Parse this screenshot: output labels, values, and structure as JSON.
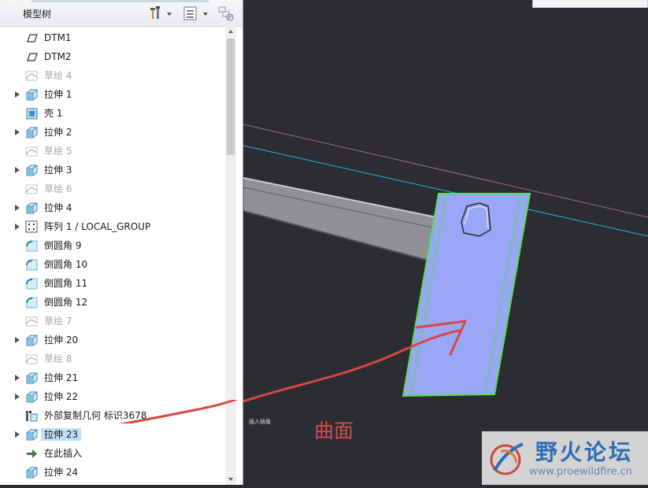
{
  "panel": {
    "title": "模型树",
    "tools_icon": "tools-icon",
    "settings_icon": "tree-settings-icon",
    "filter_icon": "tree-filter-icon"
  },
  "tree": [
    {
      "label": "DTM1",
      "icon": "datum-plane-icon",
      "expand": false,
      "dim": false,
      "selected": false
    },
    {
      "label": "DTM2",
      "icon": "datum-plane-icon",
      "expand": false,
      "dim": false,
      "selected": false
    },
    {
      "label": "草绘 4",
      "icon": "sketch-icon",
      "expand": false,
      "dim": true,
      "selected": false
    },
    {
      "label": "拉伸 1",
      "icon": "extrude-icon",
      "expand": true,
      "dim": false,
      "selected": false
    },
    {
      "label": "壳 1",
      "icon": "shell-icon",
      "expand": false,
      "dim": false,
      "selected": false
    },
    {
      "label": "拉伸 2",
      "icon": "extrude-icon",
      "expand": true,
      "dim": false,
      "selected": false
    },
    {
      "label": "草绘 5",
      "icon": "sketch-icon",
      "expand": false,
      "dim": true,
      "selected": false
    },
    {
      "label": "拉伸 3",
      "icon": "extrude-icon",
      "expand": true,
      "dim": false,
      "selected": false
    },
    {
      "label": "草绘 6",
      "icon": "sketch-icon",
      "expand": false,
      "dim": true,
      "selected": false
    },
    {
      "label": "拉伸 4",
      "icon": "extrude-icon",
      "expand": true,
      "dim": false,
      "selected": false
    },
    {
      "label": "阵列 1 / LOCAL_GROUP",
      "icon": "pattern-icon",
      "expand": true,
      "dim": false,
      "selected": false
    },
    {
      "label": "倒圆角 9",
      "icon": "round-icon",
      "expand": false,
      "dim": false,
      "selected": false
    },
    {
      "label": "倒圆角 10",
      "icon": "round-icon",
      "expand": false,
      "dim": false,
      "selected": false
    },
    {
      "label": "倒圆角 11",
      "icon": "round-icon",
      "expand": false,
      "dim": false,
      "selected": false
    },
    {
      "label": "倒圆角 12",
      "icon": "round-icon",
      "expand": false,
      "dim": false,
      "selected": false
    },
    {
      "label": "草绘 7",
      "icon": "sketch-icon",
      "expand": false,
      "dim": true,
      "selected": false
    },
    {
      "label": "拉伸 20",
      "icon": "extrude-icon",
      "expand": true,
      "dim": false,
      "selected": false
    },
    {
      "label": "草绘 8",
      "icon": "sketch-icon",
      "expand": false,
      "dim": true,
      "selected": false
    },
    {
      "label": "拉伸 21",
      "icon": "extrude-icon",
      "expand": true,
      "dim": false,
      "selected": false
    },
    {
      "label": "拉伸 22",
      "icon": "extrude-icon",
      "expand": true,
      "dim": false,
      "selected": false
    },
    {
      "label": "外部复制几何 标识3678",
      "icon": "copy-geometry-icon",
      "expand": false,
      "dim": false,
      "selected": false
    },
    {
      "label": "拉伸 23",
      "icon": "extrude-icon",
      "expand": true,
      "dim": false,
      "selected": true
    },
    {
      "label": "在此插入",
      "icon": "insert-here-icon",
      "expand": false,
      "dim": false,
      "selected": false
    },
    {
      "label": "拉伸 24",
      "icon": "extrude-icon",
      "expand": false,
      "dim": false,
      "selected": false
    }
  ],
  "viewport": {
    "small_note": "插入镜像",
    "annotation": "曲面"
  },
  "watermark": {
    "title": "野火论坛",
    "url": "www.proewildfire.cn"
  },
  "colors": {
    "background": "#2b2d33",
    "surface_fill": "#9aa6f6",
    "surface_edge": "#56e04a",
    "annotation": "#d84a4a",
    "selection": "#bfe0f7"
  }
}
